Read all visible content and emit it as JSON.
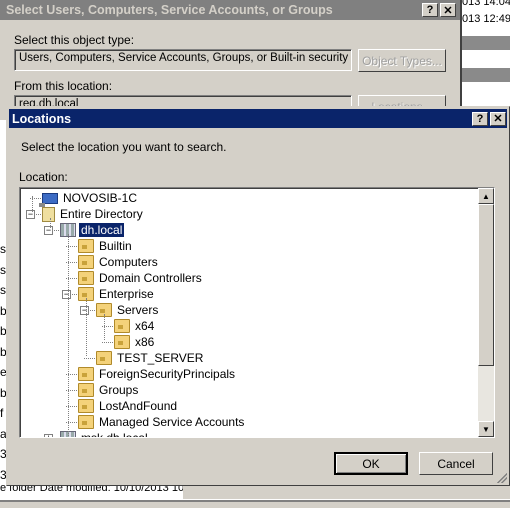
{
  "background": {
    "right_rows": [
      "013 14:04",
      "013 12:49"
    ],
    "left_chars": [
      "s",
      "s",
      "s",
      "b",
      "b",
      "b",
      "e",
      "b",
      "f",
      "a",
      "3",
      "3"
    ],
    "bottom_text": "e folder Date modified: 10/10/2013 10"
  },
  "select_dialog": {
    "title": "Select Users, Computers, Service Accounts, or Groups",
    "help_label": "?",
    "close_label": "✕",
    "object_type_label": "Select this object type:",
    "object_type_value": "Users, Computers, Service Accounts, Groups, or Built-in security principals",
    "object_types_button": "Object Types...",
    "location_label": "From this location:",
    "location_value": "reg.dh.local",
    "locations_button": "Locations..."
  },
  "locations_dialog": {
    "title": "Locations",
    "help_label": "?",
    "close_label": "✕",
    "instruction": "Select the location you want to search.",
    "location_label": "Location:",
    "tree": [
      {
        "label": "NOVOSIB-1C",
        "icon": "computer-icon",
        "level": 0,
        "expander": null,
        "selected": false
      },
      {
        "label": "Entire Directory",
        "icon": "directory-icon",
        "level": 0,
        "expander": "-",
        "selected": false
      },
      {
        "label": "dh.local",
        "icon": "domain-icon",
        "level": 1,
        "expander": "-",
        "selected": true
      },
      {
        "label": "Builtin",
        "icon": "folder-icon",
        "level": 2,
        "expander": null,
        "selected": false
      },
      {
        "label": "Computers",
        "icon": "folder-icon",
        "level": 2,
        "expander": null,
        "selected": false
      },
      {
        "label": "Domain Controllers",
        "icon": "folder-icon",
        "level": 2,
        "expander": null,
        "selected": false
      },
      {
        "label": "Enterprise",
        "icon": "folder-icon",
        "level": 2,
        "expander": "-",
        "selected": false
      },
      {
        "label": "Servers",
        "icon": "folder-icon",
        "level": 3,
        "expander": "-",
        "selected": false
      },
      {
        "label": "x64",
        "icon": "folder-icon",
        "level": 4,
        "expander": null,
        "selected": false
      },
      {
        "label": "x86",
        "icon": "folder-icon",
        "level": 4,
        "expander": null,
        "selected": false
      },
      {
        "label": "TEST_SERVER",
        "icon": "folder-icon",
        "level": 3,
        "expander": null,
        "selected": false
      },
      {
        "label": "ForeignSecurityPrincipals",
        "icon": "folder-icon",
        "level": 2,
        "expander": null,
        "selected": false
      },
      {
        "label": "Groups",
        "icon": "folder-icon",
        "level": 2,
        "expander": null,
        "selected": false
      },
      {
        "label": "LostAndFound",
        "icon": "folder-icon",
        "level": 2,
        "expander": null,
        "selected": false
      },
      {
        "label": "Managed Service Accounts",
        "icon": "folder-icon",
        "level": 2,
        "expander": null,
        "selected": false
      },
      {
        "label": "msk.dh.local",
        "icon": "domain-icon",
        "level": 1,
        "expander": "+",
        "selected": false
      }
    ],
    "ok_button": "OK",
    "cancel_button": "Cancel"
  }
}
